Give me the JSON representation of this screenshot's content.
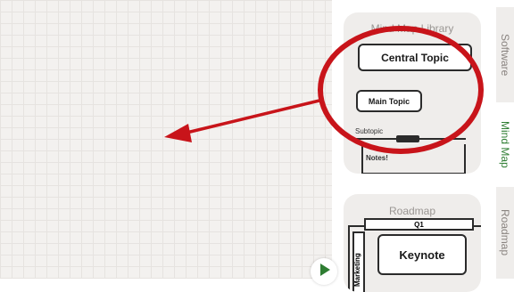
{
  "library": {
    "mindmap_card": {
      "title": "Mind Map Library",
      "central_topic": "Central Topic",
      "main_topic": "Main Topic",
      "subtopic": "Subtopic",
      "notes": "Notes!"
    },
    "roadmap_card": {
      "title": "Roadmap",
      "q1": "Q1",
      "marketing": "Marketing",
      "keynote": "Keynote"
    }
  },
  "tabs": [
    {
      "label": "Software",
      "active": false
    },
    {
      "label": "Mind Map",
      "active": true
    },
    {
      "label": "Roadmap",
      "active": false
    }
  ],
  "annotation": {
    "color": "#c8141a",
    "circle": "highlight-circle",
    "arrow": "drag-arrow"
  },
  "colors": {
    "accent": "#2e7d32",
    "canvas": "#f3f1ef",
    "card": "#efedeb"
  }
}
